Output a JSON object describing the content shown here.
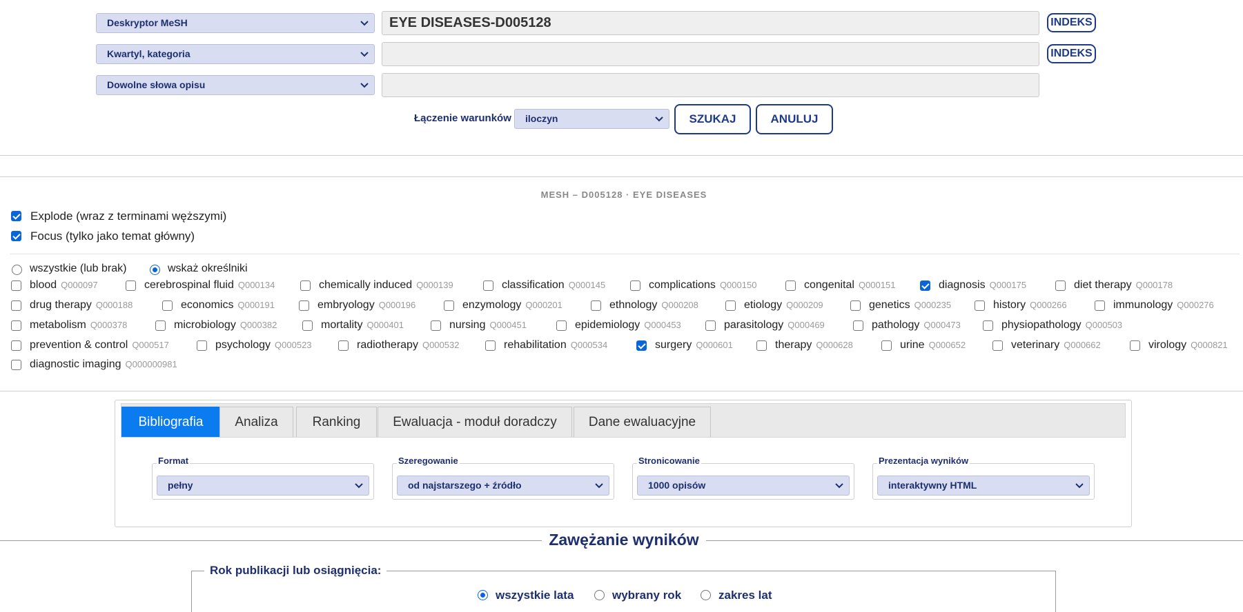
{
  "search": {
    "rows": [
      {
        "field": "Deskryptor MeSH",
        "value": "EYE DISEASES-D005128",
        "index_label": "INDEKS"
      },
      {
        "field": "Kwartyl, kategoria",
        "value": "",
        "index_label": "INDEKS"
      },
      {
        "field": "Dowolne słowa opisu",
        "value": ""
      }
    ],
    "join_label": "Łączenie warunków",
    "join_value": "iloczyn",
    "search_button": "SZUKAJ",
    "cancel_button": "ANULUJ"
  },
  "mesh": {
    "heading": "MESH – D005128  ·  EYE DISEASES",
    "explode": {
      "label": "Explode (wraz z terminami węższymi)",
      "checked": true
    },
    "focus": {
      "label": "Focus (tylko jako temat główny)",
      "checked": true
    },
    "mode_all": "wszystkie (lub brak)",
    "mode_specific": "wskaż określniki",
    "qualifiers": [
      {
        "name": "blood",
        "code": "Q000097",
        "checked": false
      },
      {
        "name": "cerebrospinal fluid",
        "code": "Q000134",
        "checked": false
      },
      {
        "name": "chemically induced",
        "code": "Q000139",
        "checked": false
      },
      {
        "name": "classification",
        "code": "Q000145",
        "checked": false
      },
      {
        "name": "complications",
        "code": "Q000150",
        "checked": false
      },
      {
        "name": "congenital",
        "code": "Q000151",
        "checked": false
      },
      {
        "name": "diagnosis",
        "code": "Q000175",
        "checked": true
      },
      {
        "name": "diet therapy",
        "code": "Q000178",
        "checked": false
      },
      {
        "name": "drug therapy",
        "code": "Q000188",
        "checked": false
      },
      {
        "name": "economics",
        "code": "Q000191",
        "checked": false
      },
      {
        "name": "embryology",
        "code": "Q000196",
        "checked": false
      },
      {
        "name": "enzymology",
        "code": "Q000201",
        "checked": false
      },
      {
        "name": "ethnology",
        "code": "Q000208",
        "checked": false
      },
      {
        "name": "etiology",
        "code": "Q000209",
        "checked": false
      },
      {
        "name": "genetics",
        "code": "Q000235",
        "checked": false
      },
      {
        "name": "history",
        "code": "Q000266",
        "checked": false
      },
      {
        "name": "immunology",
        "code": "Q000276",
        "checked": false
      },
      {
        "name": "metabolism",
        "code": "Q000378",
        "checked": false
      },
      {
        "name": "microbiology",
        "code": "Q000382",
        "checked": false
      },
      {
        "name": "mortality",
        "code": "Q000401",
        "checked": false
      },
      {
        "name": "nursing",
        "code": "Q000451",
        "checked": false
      },
      {
        "name": "epidemiology",
        "code": "Q000453",
        "checked": false
      },
      {
        "name": "parasitology",
        "code": "Q000469",
        "checked": false
      },
      {
        "name": "pathology",
        "code": "Q000473",
        "checked": false
      },
      {
        "name": "physiopathology",
        "code": "Q000503",
        "checked": false
      },
      {
        "name": "prevention & control",
        "code": "Q000517",
        "checked": false
      },
      {
        "name": "psychology",
        "code": "Q000523",
        "checked": false
      },
      {
        "name": "radiotherapy",
        "code": "Q000532",
        "checked": false
      },
      {
        "name": "rehabilitation",
        "code": "Q000534",
        "checked": false
      },
      {
        "name": "surgery",
        "code": "Q000601",
        "checked": true
      },
      {
        "name": "therapy",
        "code": "Q000628",
        "checked": false
      },
      {
        "name": "urine",
        "code": "Q000652",
        "checked": false
      },
      {
        "name": "veterinary",
        "code": "Q000662",
        "checked": false
      },
      {
        "name": "virology",
        "code": "Q000821",
        "checked": false
      },
      {
        "name": "diagnostic imaging",
        "code": "Q000000981",
        "checked": false
      }
    ]
  },
  "tabs": [
    {
      "label": "Bibliografia",
      "active": true
    },
    {
      "label": "Analiza",
      "active": false
    },
    {
      "label": "Ranking",
      "active": false
    },
    {
      "label": "Ewaluacja - moduł doradczy",
      "active": false
    },
    {
      "label": "Dane ewaluacyjne",
      "active": false
    }
  ],
  "options": [
    {
      "legend": "Format",
      "value": "pełny"
    },
    {
      "legend": "Szeregowanie",
      "value": "od najstarszego + źródło"
    },
    {
      "legend": "Stronicowanie",
      "value": "1000 opisów"
    },
    {
      "legend": "Prezentacja wyników",
      "value": "interaktywny HTML"
    }
  ],
  "narrowing": {
    "title": "Zawężanie wyników",
    "year_legend": "Rok publikacji lub osiągnięcia:",
    "year_options": [
      {
        "label": "wszystkie lata",
        "selected": true
      },
      {
        "label": "wybrany rok",
        "selected": false
      },
      {
        "label": "zakres lat",
        "selected": false
      }
    ]
  },
  "colors": {
    "accent": "#0b7bf0",
    "brand": "#1d3a8a",
    "select_bg": "#d9ddf2"
  }
}
